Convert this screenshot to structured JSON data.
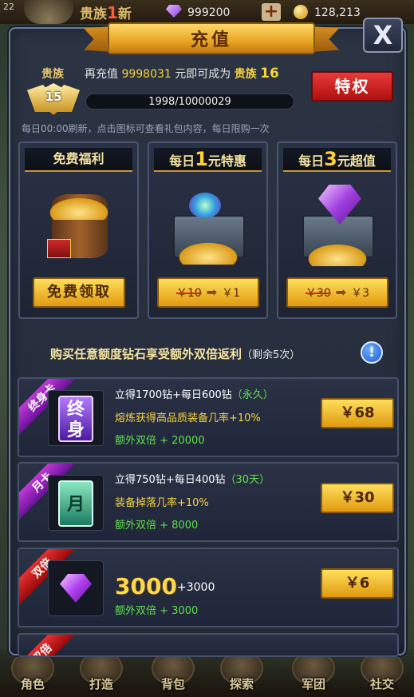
{
  "hud": {
    "fps": "22",
    "vip_text": "贵族",
    "vip_level": "1",
    "vip_suffix": "新",
    "gems": "999200",
    "add": "+",
    "coins": "128,213"
  },
  "modal": {
    "title": "充值",
    "close": "X"
  },
  "vip": {
    "label": "贵族",
    "level": "15",
    "msg_prefix": "再充值",
    "amount": "9998031",
    "msg_mid": "元即可成为",
    "target_label": "贵族",
    "target_level": "16",
    "progress_text": "1998/10000029",
    "progress_fraction": 0.0002,
    "privilege_button": "特权"
  },
  "refresh_note": "每日00:00刷新，点击图标可查看礼包内容，每日限购一次",
  "daily_gifts": [
    {
      "title": "免费福利",
      "button": "免费领取"
    },
    {
      "title_pre": "每日",
      "title_num": "1",
      "title_post": "元特惠",
      "old_price": "￥10",
      "arrow": "➡",
      "new_price": "￥1"
    },
    {
      "title_pre": "每日",
      "title_num": "3",
      "title_post": "元超值",
      "old_price": "￥30",
      "arrow": "➡",
      "new_price": "￥3"
    }
  ],
  "bonus": {
    "text": "购买任意额度钻石享受额外双倍返利",
    "remain": "（剩余5次）",
    "info": "!"
  },
  "products": [
    {
      "tag": "终身卡",
      "card_text": "终身",
      "line1": "立得1700钻+每日600钻",
      "line1_note": "（永久）",
      "line2": "熔炼获得高品质装备几率+10%",
      "line3": "额外双倍 + 20000",
      "price": "￥68"
    },
    {
      "tag": "月卡",
      "card_text": "月",
      "line1": "立得750钻+每日400钻",
      "line1_note": "（30天）",
      "line2": "装备掉落几率+10%",
      "line3": "额外双倍 + 8000",
      "price": "￥30"
    },
    {
      "tag": "双倍",
      "amount": "3000",
      "bonus_amount": "+3000",
      "line3": "额外双倍 + 3000",
      "price": "￥6"
    },
    {
      "tag": "双倍"
    }
  ],
  "nav": [
    "角色",
    "打造",
    "背包",
    "探索",
    "军团",
    "社交"
  ],
  "colors": {
    "gold_button": "#ffde5a",
    "privilege_red": "#e83a3a",
    "green_text": "#5ee04a",
    "yellow_text": "#f5d33a"
  }
}
